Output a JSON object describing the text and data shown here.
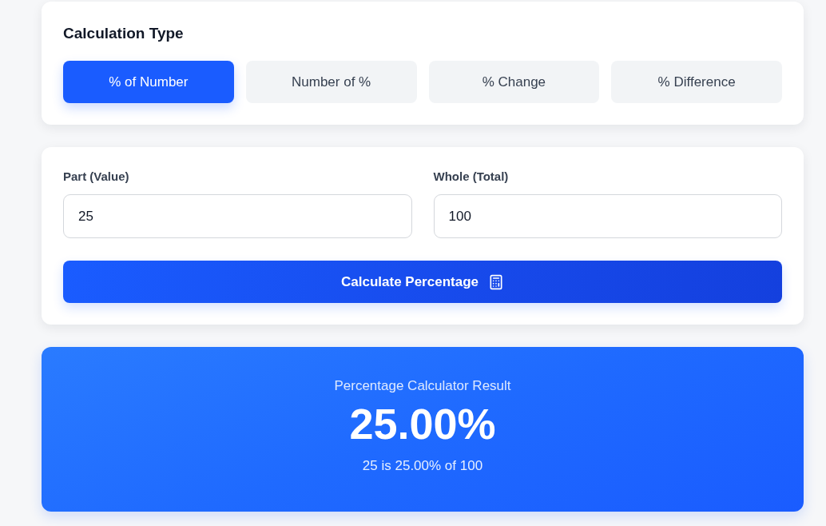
{
  "calculation_type": {
    "title": "Calculation Type",
    "tabs": [
      {
        "label": "% of Number",
        "selected": true
      },
      {
        "label": "Number of %",
        "selected": false
      },
      {
        "label": "% Change",
        "selected": false
      },
      {
        "label": "% Difference",
        "selected": false
      }
    ]
  },
  "inputs": {
    "fields": [
      {
        "label": "Part (Value)",
        "value": "25"
      },
      {
        "label": "Whole (Total)",
        "value": "100"
      }
    ],
    "calculate_button": {
      "label": "Calculate Percentage"
    }
  },
  "result": {
    "title": "Percentage Calculator Result",
    "value": "25.00%",
    "explanation": "25 is 25.00% of 100"
  }
}
